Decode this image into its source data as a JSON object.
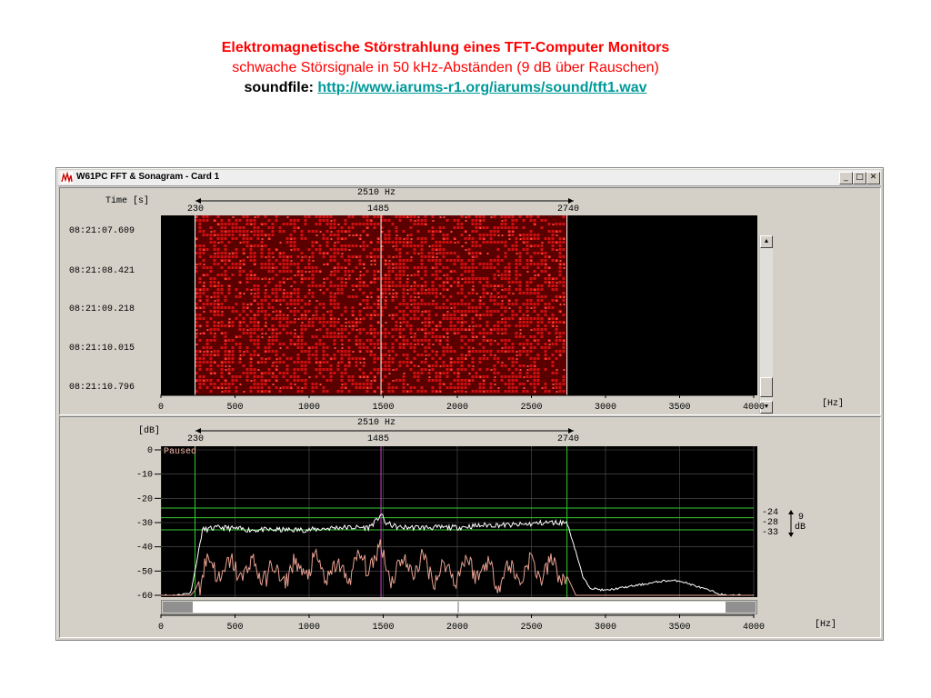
{
  "caption": {
    "title": "Elektromagnetische Störstrahlung eines TFT-Computer Monitors",
    "subtitle": "schwache Störsignale in 50 kHz-Abständen (9 dB über Rauschen)",
    "soundfile_label": "soundfile:",
    "soundfile_link": "http://www.iarums-r1.org/iarums/sound/tft1.wav"
  },
  "window": {
    "title": "W61PC FFT & Sonagram  - Card 1",
    "buttons": {
      "minimize": "_",
      "maximize": "□",
      "close": "✕"
    }
  },
  "sonagram": {
    "time_label": "Time [s]",
    "times": [
      "08:21:07.609",
      "08:21:08.421",
      "08:21:09.218",
      "08:21:10.015",
      "08:21:10.796"
    ],
    "span_label": "2510 Hz",
    "marker_labels": [
      "230",
      "1485",
      "2740"
    ],
    "x_ticks": [
      "0",
      "500",
      "1000",
      "1500",
      "2000",
      "2500",
      "3000",
      "3500",
      "4000"
    ],
    "x_unit": "[Hz]"
  },
  "spectrum": {
    "db_label": "[dB]",
    "span_label": "2510 Hz",
    "marker_labels": [
      "230",
      "1485",
      "2740"
    ],
    "y_ticks": [
      "0",
      "-10",
      "-20",
      "-30",
      "-40",
      "-50",
      "-60"
    ],
    "status": "Paused",
    "level_labels": [
      "-24",
      "-28",
      "-33"
    ],
    "level_diff": "9",
    "level_unit": "dB",
    "x_ticks": [
      "0",
      "500",
      "1000",
      "1500",
      "2000",
      "2500",
      "3000",
      "3500",
      "4000"
    ],
    "x_unit": "[Hz]"
  },
  "chart_data": [
    {
      "type": "heatmap",
      "title": "",
      "x_range": [
        0,
        4000
      ],
      "x_ticks": [
        0,
        500,
        1000,
        1500,
        2000,
        2500,
        3000,
        3500,
        4000
      ],
      "y_ticks": [
        "08:21:07.609",
        "08:21:08.421",
        "08:21:09.218",
        "08:21:10.015",
        "08:21:10.796"
      ],
      "band_hz": [
        230,
        2740
      ],
      "markers_hz": [
        230,
        1485,
        2740
      ],
      "span_hz": 2510,
      "colors": {
        "background": "#000000",
        "signal": "#d01010",
        "marker": "#ffffff"
      }
    },
    {
      "type": "line",
      "title": "",
      "xlim": [
        0,
        4000
      ],
      "ylim": [
        -60,
        0
      ],
      "x_ticks": [
        0,
        500,
        1000,
        1500,
        2000,
        2500,
        3000,
        3500,
        4000
      ],
      "y_ticks": [
        0,
        -10,
        -20,
        -30,
        -40,
        -50,
        -60
      ],
      "markers_hz": [
        230,
        1485,
        2740
      ],
      "level_lines_db": [
        -24,
        -28,
        -33
      ],
      "series": [
        {
          "color": "#ffffff",
          "x": [
            0,
            100,
            200,
            230,
            280,
            400,
            600,
            800,
            1000,
            1200,
            1400,
            1460,
            1485,
            1510,
            1600,
            1800,
            2000,
            2200,
            2400,
            2600,
            2700,
            2740,
            2800,
            2850,
            2900,
            3000,
            3200,
            3400,
            3500,
            3600,
            3700,
            3800,
            4000
          ],
          "y": [
            -60,
            -60,
            -59,
            -50,
            -33,
            -32,
            -33,
            -33,
            -33,
            -32,
            -32,
            -29,
            -26,
            -30,
            -32,
            -32,
            -32,
            -31,
            -31,
            -30,
            -30,
            -30,
            -42,
            -53,
            -57,
            -58,
            -56,
            -54,
            -54,
            -56,
            -58,
            -60,
            -60
          ]
        },
        {
          "color": "#e8a090",
          "x": [
            0,
            200,
            230,
            300,
            400,
            600,
            800,
            1000,
            1200,
            1400,
            1485,
            1550,
            1700,
            1900,
            2100,
            2300,
            2500,
            2700,
            2740,
            2800,
            4000
          ],
          "y": [
            -60,
            -60,
            -58,
            -48,
            -50,
            -49,
            -52,
            -48,
            -51,
            -46,
            -43,
            -50,
            -47,
            -51,
            -48,
            -52,
            -49,
            -50,
            -52,
            -60,
            -60
          ]
        }
      ]
    }
  ]
}
